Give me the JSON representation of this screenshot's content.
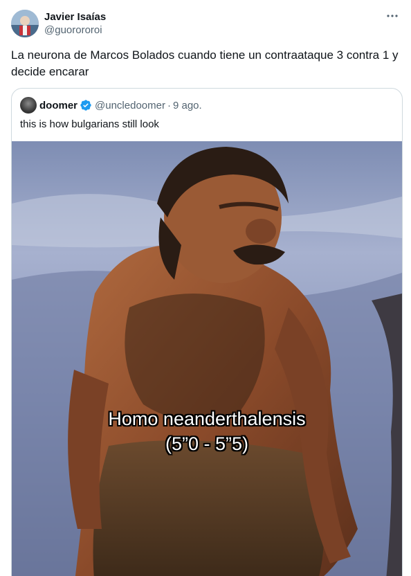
{
  "tweet": {
    "display_name": "Javier Isaías",
    "handle": "@guorororoi",
    "text": "La neurona de Marcos Bolados cuando tiene un contraataque 3 contra 1 y decide encarar",
    "more_icon": "more-horizontal-icon"
  },
  "quoted_tweet": {
    "display_name": "doomer",
    "verified_icon": "verified-badge-icon",
    "handle": "@uncledoomer",
    "separator": "·",
    "date": "9 ago.",
    "text": "this is how bulgarians still look",
    "image_caption_line1": "Homo neanderthalensis",
    "image_caption_line2": "(5”0 - 5”5)"
  },
  "colors": {
    "text_primary": "#0f1419",
    "text_secondary": "#536471",
    "border": "#cfd9de",
    "verified_blue": "#1d9bf0"
  }
}
